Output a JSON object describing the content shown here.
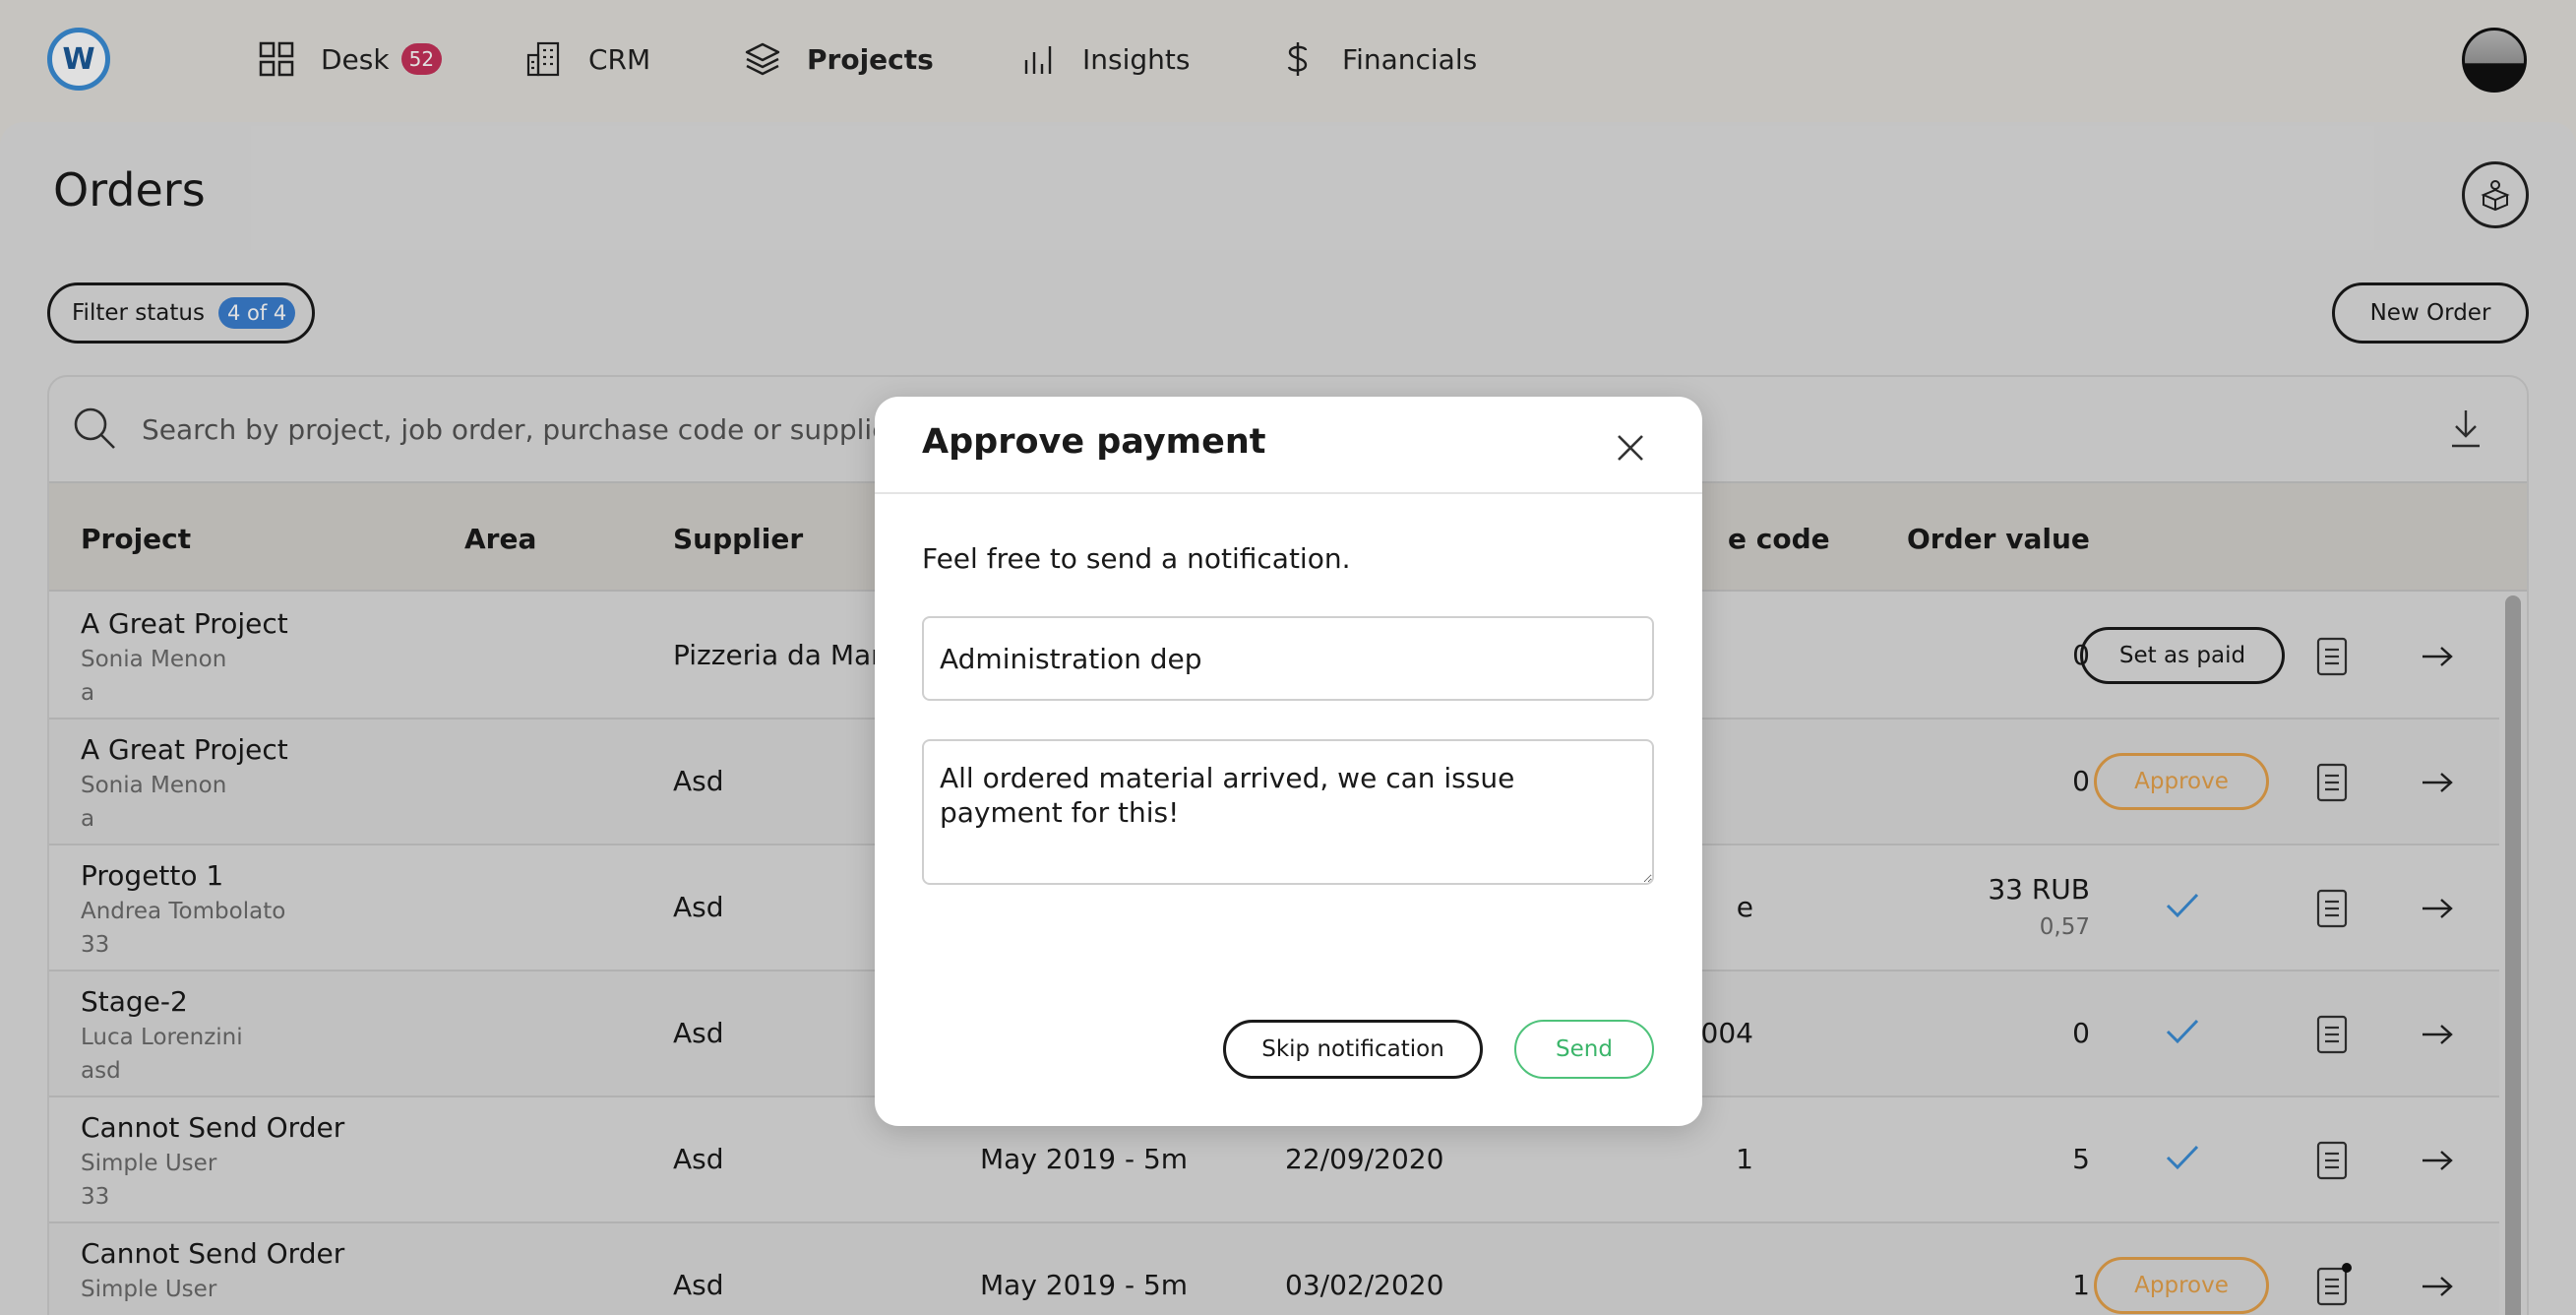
{
  "nav": {
    "logo_letter": "W",
    "items": [
      {
        "label": "Desk",
        "icon": "grid-icon",
        "badge": "52"
      },
      {
        "label": "CRM",
        "icon": "building-icon"
      },
      {
        "label": "Projects",
        "icon": "layers-icon"
      },
      {
        "label": "Insights",
        "icon": "bar-chart-icon"
      },
      {
        "label": "Financials",
        "icon": "dollar-icon"
      }
    ],
    "active": "Projects"
  },
  "page": {
    "title": "Orders",
    "filter_label": "Filter status",
    "filter_count": "4 of 4",
    "new_order_label": "New Order"
  },
  "search": {
    "placeholder": "Search by project, job order, purchase code or supplier"
  },
  "table": {
    "columns": {
      "project": "Project",
      "area": "Area",
      "supplier": "Supplier",
      "code": "e code",
      "value": "Order value"
    },
    "rows": [
      {
        "project": "A Great Project",
        "owner": "Sonia Menon",
        "note": "a",
        "supplier": "Pizzeria da Mari",
        "date1": "",
        "date2": "",
        "code": "",
        "value": "0",
        "value_sub": "",
        "action": "Set as paid"
      },
      {
        "project": "A Great Project",
        "owner": "Sonia Menon",
        "note": "a",
        "supplier": "Asd",
        "date1": "",
        "date2": "",
        "code": "",
        "value": "0",
        "value_sub": "",
        "action": "Approve"
      },
      {
        "project": "Progetto 1",
        "owner": "Andrea Tombolato",
        "note": "33",
        "supplier": "Asd",
        "date1": "",
        "date2": "",
        "code": "e",
        "value": "33 RUB",
        "value_sub": "0,57",
        "action": "check"
      },
      {
        "project": "Stage-2",
        "owner": "Luca Lorenzini",
        "note": "asd",
        "supplier": "Asd",
        "date1": "",
        "date2": "",
        "code": "3004",
        "value": "0",
        "value_sub": "",
        "action": "check"
      },
      {
        "project": "Cannot Send Order",
        "owner": "Simple User",
        "note": "33",
        "supplier": "Asd",
        "date1": "May 2019 - 5m",
        "date2": "22/09/2020",
        "code": "1",
        "value": "5",
        "value_sub": "",
        "action": "check"
      },
      {
        "project": "Cannot Send Order",
        "owner": "Simple User",
        "note": "",
        "supplier": "Asd",
        "date1": "May 2019 - 5m",
        "date2": "03/02/2020",
        "code": "",
        "value": "1",
        "value_sub": "",
        "action": "Approve"
      }
    ]
  },
  "modal": {
    "title": "Approve payment",
    "text": "Feel free to send a notification.",
    "recipient_value": "Administration dep",
    "message_value": "All ordered material arrived, we can issue payment for this!",
    "skip_label": "Skip notification",
    "send_label": "Send"
  },
  "colors": {
    "accent_blue": "#3b7fd0",
    "badge_red": "#c6325a",
    "approve_orange": "#e6a24a",
    "send_green": "#3bb56a",
    "check_blue": "#3b8ed6"
  }
}
